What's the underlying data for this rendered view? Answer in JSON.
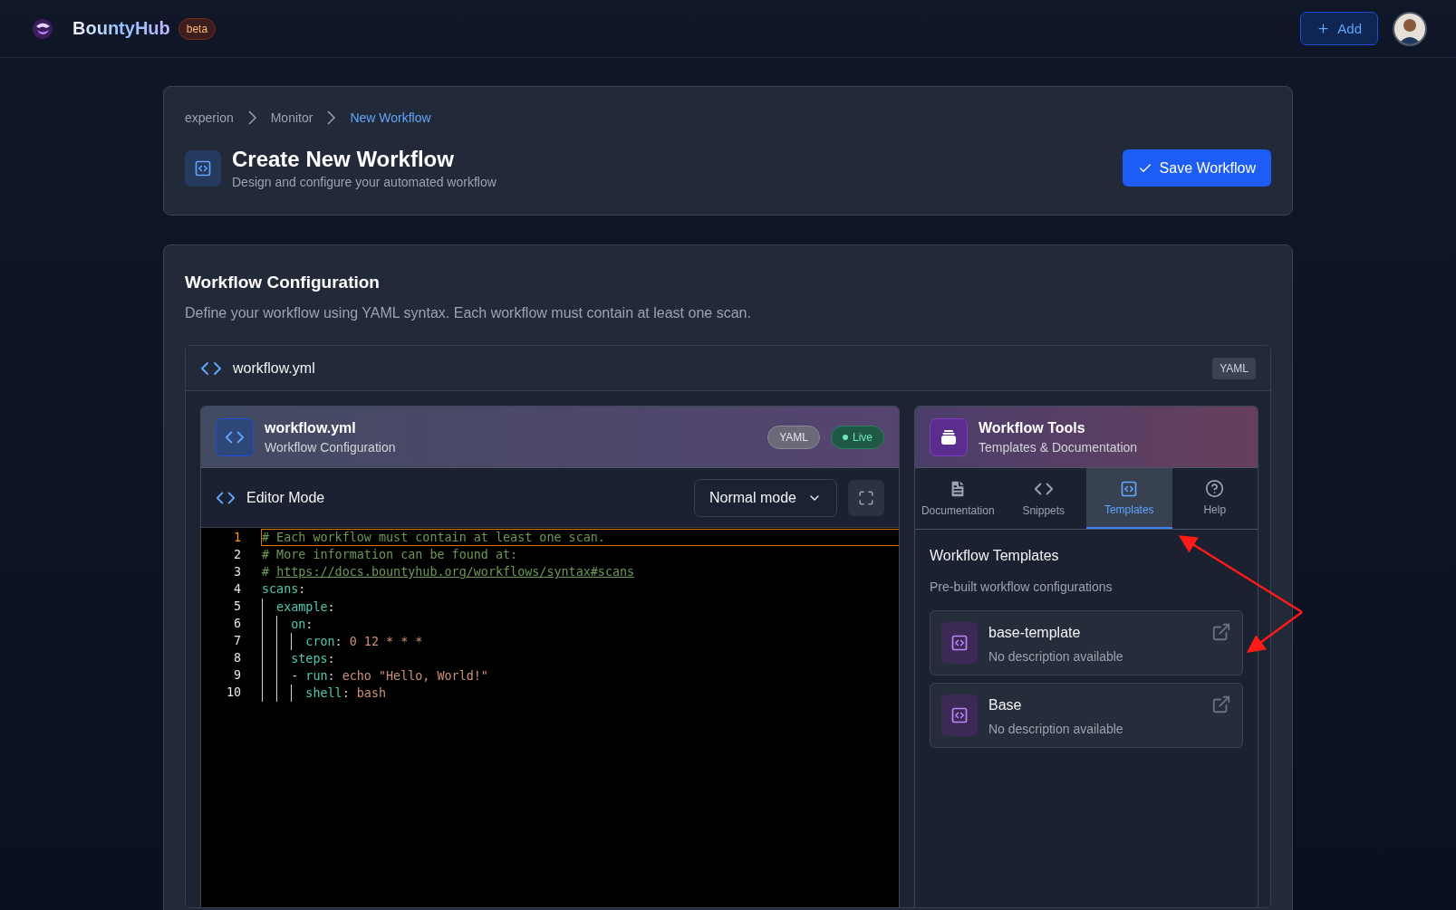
{
  "header": {
    "brand": "BountyHub",
    "badge": "beta",
    "add_button": "Add"
  },
  "breadcrumbs": [
    {
      "label": "experion",
      "selected": false
    },
    {
      "label": "Monitor",
      "selected": false
    },
    {
      "label": "New Workflow",
      "selected": true
    }
  ],
  "page": {
    "title": "Create New Workflow",
    "subtitle": "Design and configure your automated workflow",
    "save_button": "Save Workflow"
  },
  "config": {
    "title": "Workflow Configuration",
    "description": "Define your workflow using YAML syntax. Each workflow must contain at least one scan.",
    "file_name": "workflow.yml",
    "file_badge": "YAML"
  },
  "editor": {
    "title": "workflow.yml",
    "subtitle": "Workflow Configuration",
    "badges": [
      {
        "label": "YAML",
        "kind": "neutral"
      },
      {
        "label": "Live",
        "kind": "live"
      }
    ],
    "mode_label": "Editor Mode",
    "mode_select": "Normal mode",
    "lines": [
      {
        "number": "1",
        "active": true,
        "tokens": [
          {
            "kind": "comment",
            "text": "# Each workflow must contain at least one scan."
          }
        ]
      },
      {
        "number": "2",
        "active": false,
        "tokens": [
          {
            "kind": "comment",
            "text": "# More information can be found at:"
          }
        ]
      },
      {
        "number": "3",
        "active": false,
        "tokens": [
          {
            "kind": "comment",
            "text": "# "
          },
          {
            "kind": "link",
            "text": "https://docs.bountyhub.org/workflows/syntax#scans"
          }
        ]
      },
      {
        "number": "4",
        "active": false,
        "tokens": [
          {
            "kind": "key",
            "text": "scans"
          },
          {
            "kind": "punct",
            "text": ":"
          }
        ]
      },
      {
        "number": "5",
        "active": false,
        "tokens": [
          {
            "kind": "guide"
          },
          {
            "kind": "key",
            "text": "example"
          },
          {
            "kind": "punct",
            "text": ":"
          }
        ]
      },
      {
        "number": "6",
        "active": false,
        "tokens": [
          {
            "kind": "guide"
          },
          {
            "kind": "guide"
          },
          {
            "kind": "key",
            "text": "on"
          },
          {
            "kind": "punct",
            "text": ":"
          }
        ]
      },
      {
        "number": "7",
        "active": false,
        "tokens": [
          {
            "kind": "guide"
          },
          {
            "kind": "guide"
          },
          {
            "kind": "guide"
          },
          {
            "kind": "key",
            "text": "cron"
          },
          {
            "kind": "punct",
            "text": ": "
          },
          {
            "kind": "value",
            "text": "0 12 * * *"
          }
        ]
      },
      {
        "number": "8",
        "active": false,
        "tokens": [
          {
            "kind": "guide"
          },
          {
            "kind": "guide"
          },
          {
            "kind": "key",
            "text": "steps"
          },
          {
            "kind": "punct",
            "text": ":"
          }
        ]
      },
      {
        "number": "9",
        "active": false,
        "tokens": [
          {
            "kind": "guide"
          },
          {
            "kind": "guide"
          },
          {
            "kind": "punct",
            "text": "- "
          },
          {
            "kind": "key",
            "text": "run"
          },
          {
            "kind": "punct",
            "text": ": "
          },
          {
            "kind": "value",
            "text": "echo \"Hello, World!\""
          }
        ]
      },
      {
        "number": "10",
        "active": false,
        "tokens": [
          {
            "kind": "guide"
          },
          {
            "kind": "guide"
          },
          {
            "kind": "guide"
          },
          {
            "kind": "key",
            "text": "shell"
          },
          {
            "kind": "punct",
            "text": ": "
          },
          {
            "kind": "value",
            "text": "bash"
          }
        ]
      }
    ]
  },
  "tools": {
    "title": "Workflow Tools",
    "subtitle": "Templates & Documentation",
    "tabs": [
      {
        "label": "Documentation",
        "kind": "doc",
        "selected": false
      },
      {
        "label": "Snippets",
        "kind": "code",
        "selected": false
      },
      {
        "label": "Templates",
        "kind": "template",
        "selected": true
      },
      {
        "label": "Help",
        "kind": "help",
        "selected": false
      }
    ],
    "section_title": "Workflow Templates",
    "section_subtitle": "Pre-built workflow configurations",
    "templates": [
      {
        "name": "base-template",
        "description": "No description available"
      },
      {
        "name": "Base",
        "description": "No description available"
      }
    ]
  }
}
